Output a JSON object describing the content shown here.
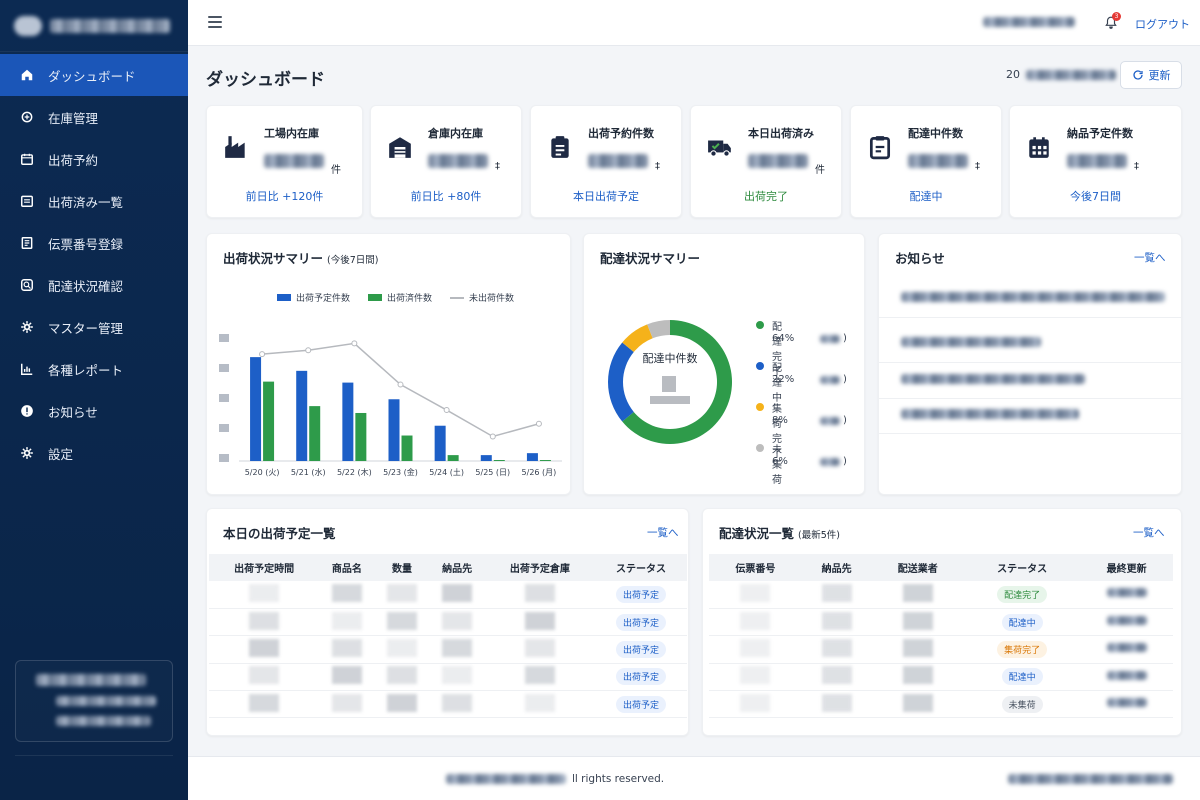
{
  "header": {
    "logout": "ログアウト",
    "notification_count": "3"
  },
  "sidebar": {
    "items": [
      {
        "label": "ダッシュボード",
        "icon": "home-icon",
        "active": true
      },
      {
        "label": "在庫管理",
        "icon": "inventory-icon"
      },
      {
        "label": "出荷予約",
        "icon": "calendar-icon"
      },
      {
        "label": "出荷済み一覧",
        "icon": "list-icon"
      },
      {
        "label": "伝票番号登録",
        "icon": "document-icon"
      },
      {
        "label": "配達状況確認",
        "icon": "search-icon"
      },
      {
        "label": "マスター管理",
        "icon": "gear-icon"
      },
      {
        "label": "各種レポート",
        "icon": "report-icon"
      },
      {
        "label": "お知らせ",
        "icon": "alert-icon"
      },
      {
        "label": "設定",
        "icon": "settings-icon"
      }
    ]
  },
  "page": {
    "title": "ダッシュボード",
    "date_prefix": "20",
    "refresh": "更新"
  },
  "kpis": [
    {
      "label": "工場内在庫",
      "unit": "件",
      "sub": "前日比 +120件",
      "icon": "factory-icon",
      "sub_color": "blue"
    },
    {
      "label": "倉庫内在庫",
      "unit": "‡",
      "sub": "前日比 +80件",
      "icon": "warehouse-icon",
      "sub_color": "blue"
    },
    {
      "label": "出荷予約件数",
      "unit": "‡",
      "sub": "本日出荷予定",
      "icon": "clipboard-icon",
      "sub_color": "blue"
    },
    {
      "label": "本日出荷済み",
      "unit": "件",
      "sub": "出荷完了",
      "icon": "truck-icon",
      "sub_color": "green"
    },
    {
      "label": "配達中件数",
      "unit": "‡",
      "sub": "配達中",
      "icon": "delivery-icon",
      "sub_color": "blue"
    },
    {
      "label": "納品予定件数",
      "unit": "‡",
      "sub": "今後7日間",
      "icon": "calendar-icon",
      "sub_color": "blue"
    }
  ],
  "shipping_summary": {
    "title": "出荷状況サマリー",
    "subtitle": "(今後7日間)"
  },
  "delivery_summary": {
    "title": "配達状況サマリー",
    "center_label": "配達中件数"
  },
  "notices": {
    "title": "お知らせ",
    "link": "一覧へ"
  },
  "today_table": {
    "title": "本日の出荷予定一覧",
    "link": "一覧へ",
    "columns": [
      "出荷予定時間",
      "商品名",
      "数量",
      "納品先",
      "出荷予定倉庫",
      "ステータス"
    ],
    "statuses": [
      "出荷予定",
      "出荷予定",
      "出荷予定",
      "出荷予定",
      "出荷予定"
    ]
  },
  "delivery_table": {
    "title": "配達状況一覧",
    "subtitle": "(最新5件)",
    "link": "一覧へ",
    "columns": [
      "伝票番号",
      "納品先",
      "配送業者",
      "ステータス",
      "最終更新"
    ],
    "statuses": [
      {
        "label": "配達完了",
        "color": "green"
      },
      {
        "label": "配達中",
        "color": "blue"
      },
      {
        "label": "集荷完了",
        "color": "orange"
      },
      {
        "label": "配達中",
        "color": "blue"
      },
      {
        "label": "未集荷",
        "color": "gray"
      }
    ]
  },
  "footer": {
    "text": "ll rights reserved."
  },
  "chart_data": [
    {
      "type": "bar",
      "categories": [
        "5/20 (火)",
        "5/21 (水)",
        "5/22 (木)",
        "5/23 (金)",
        "5/24 (土)",
        "5/25 (日)",
        "5/26 (月)"
      ],
      "series": [
        {
          "name": "出荷予定件数",
          "type": "bar",
          "color": "#1d5fc7",
          "values": [
            106,
            92,
            80,
            63,
            36,
            6,
            8
          ]
        },
        {
          "name": "出荷済件数",
          "type": "bar",
          "color": "#2e9b4a",
          "values": [
            81,
            56,
            49,
            26,
            6,
            1,
            1
          ]
        },
        {
          "name": "未出荷件数",
          "type": "line",
          "color": "#b6b9be",
          "values": [
            109,
            113,
            120,
            78,
            52,
            25,
            38
          ]
        }
      ],
      "ylim": [
        0,
        150
      ],
      "legend": "top"
    },
    {
      "type": "pie",
      "categories": [
        "配達完了",
        "配達中",
        "集荷完了",
        "未集荷"
      ],
      "values": [
        64,
        22,
        8,
        6
      ],
      "labels": [
        "64%",
        "22%",
        "8%",
        "6%"
      ],
      "colors": [
        "#2e9b4a",
        "#1d5fc7",
        "#f5b21a",
        "#bdbdbd"
      ],
      "legend": "right"
    }
  ]
}
